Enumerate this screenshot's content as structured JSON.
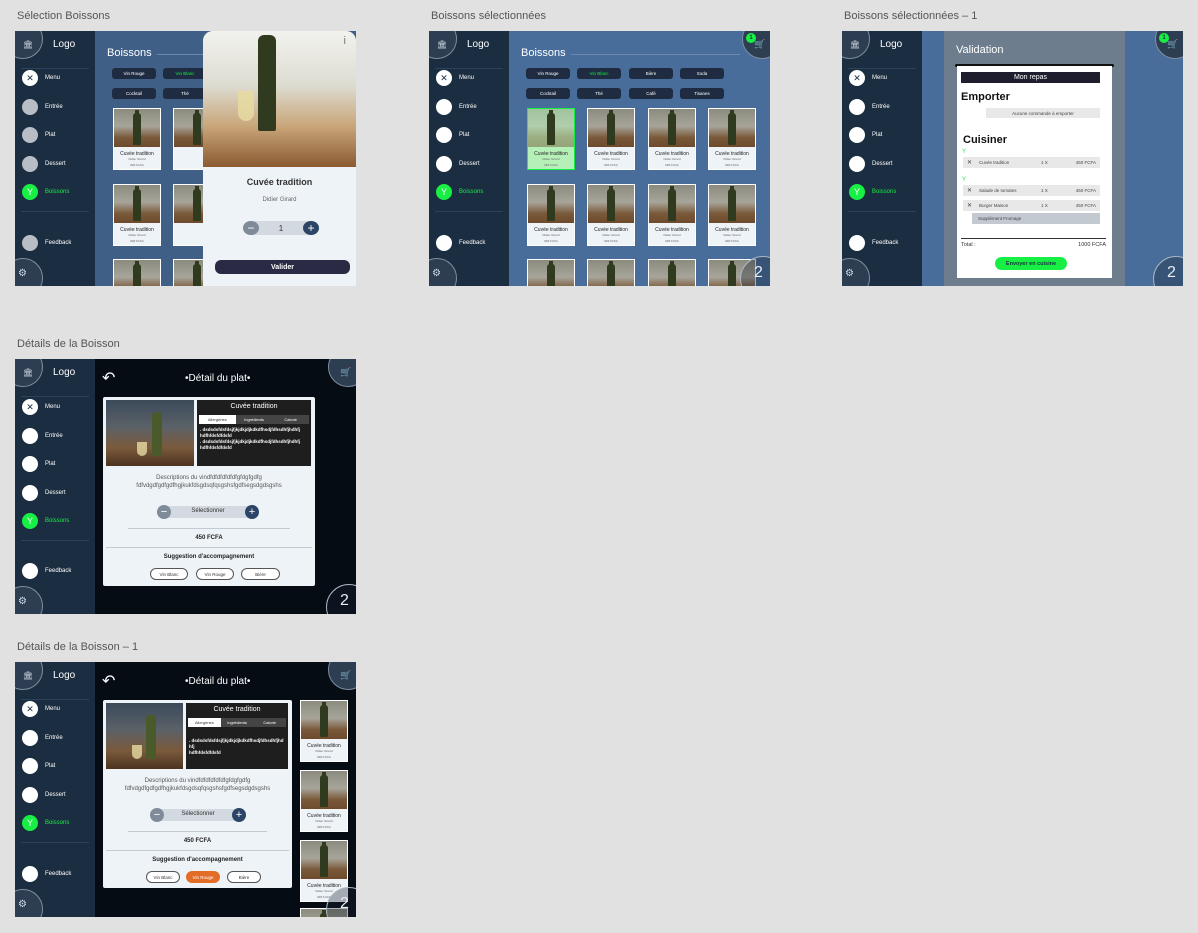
{
  "artboards": {
    "a1": "Sélection Boissons",
    "a2": "Boissons sélectionnées",
    "a3": "Boissons sélectionnées – 1",
    "a4": "Détails de la Boisson",
    "a5": "Détails de la Boisson – 1"
  },
  "sidebar": {
    "logo": "Logo",
    "items": [
      "Menu",
      "Entrée",
      "Plat",
      "Dessert",
      "Boissons",
      "Feedback"
    ]
  },
  "cart_badge": "1",
  "cart_count": "2",
  "drinks": {
    "title": "Boissons",
    "filters": [
      "Vin Rouge",
      "Vin Blanc",
      "Bière",
      "Soda",
      "Cocktail",
      "Thé",
      "Café",
      "Tisanes"
    ],
    "selected_filter": "Vin Blanc",
    "card": {
      "name": "Cuvée tradition",
      "sub": "Didier Girard",
      "price": "### FCFA"
    }
  },
  "popup": {
    "name": "Cuvée tradition",
    "producer": "Didier Girard",
    "quantity": "1",
    "validate": "Valider",
    "info": "i"
  },
  "validation": {
    "title": "Validation",
    "mon_repas": "Mon repas",
    "emporter": "Emporter",
    "no_takeaway": "Aucune commande à emporter",
    "cuisiner": "Cuisiner",
    "items": [
      {
        "name": "Cuvée tradition",
        "qty": "1 X",
        "price": "450 FCFA"
      },
      {
        "name": "Salade de tomates",
        "qty": "1 X",
        "price": "450 FCFA"
      },
      {
        "name": "Burger Maison",
        "qty": "1 X",
        "price": "450 FCFA"
      }
    ],
    "supplement": "Supplément Fromage",
    "total_label": "Total :",
    "total_value": "1000 FCFA",
    "send": "Envoyer en cuisine"
  },
  "detail": {
    "title": "Détail du plat",
    "name": "Cuvée tradition",
    "tabs": [
      "Allergènes",
      "Ingrédients",
      "Calorie"
    ],
    "lines_a": [
      ". dsdsdsfdsfdsjfjkjdkjdjkdkdfhsdjfdhsdhfjhdhfj",
      "hdfhfdsfdfdsfd",
      ". dsdsdsfdsfdsjfjkjdkjdjkdkdfhsdjfdhsdhfjhdhfj",
      "hdfhfdsfdfdsfd"
    ],
    "lines_b": [
      ". dsdsdsfdsfdsjfjkjdkjdjkdkdfhsdjfdhsdhfjhdhfj",
      "hdfhfdsfdfdsfd"
    ],
    "desc1": "Descriptions du vindfdfdfdfdfdfgfdgfgdfg",
    "desc2": "fdfvdgdfgdfgdfhgjkukfdsgdsqfqsgshsfgdfsegsdgdsgshs",
    "select": "Sélectionner",
    "price": "450 FCFA",
    "suggestion": "Suggestion d'accompagnement",
    "sugg_items": [
      "Vin Blanc",
      "Vin Rouge",
      "Bière"
    ],
    "sugg_selected": "Vin Rouge"
  },
  "colors": {
    "accent_green": "#18ef45",
    "sidebar": "#1b2d40",
    "main_blue": "#486d9a",
    "orange": "#e36c27"
  }
}
